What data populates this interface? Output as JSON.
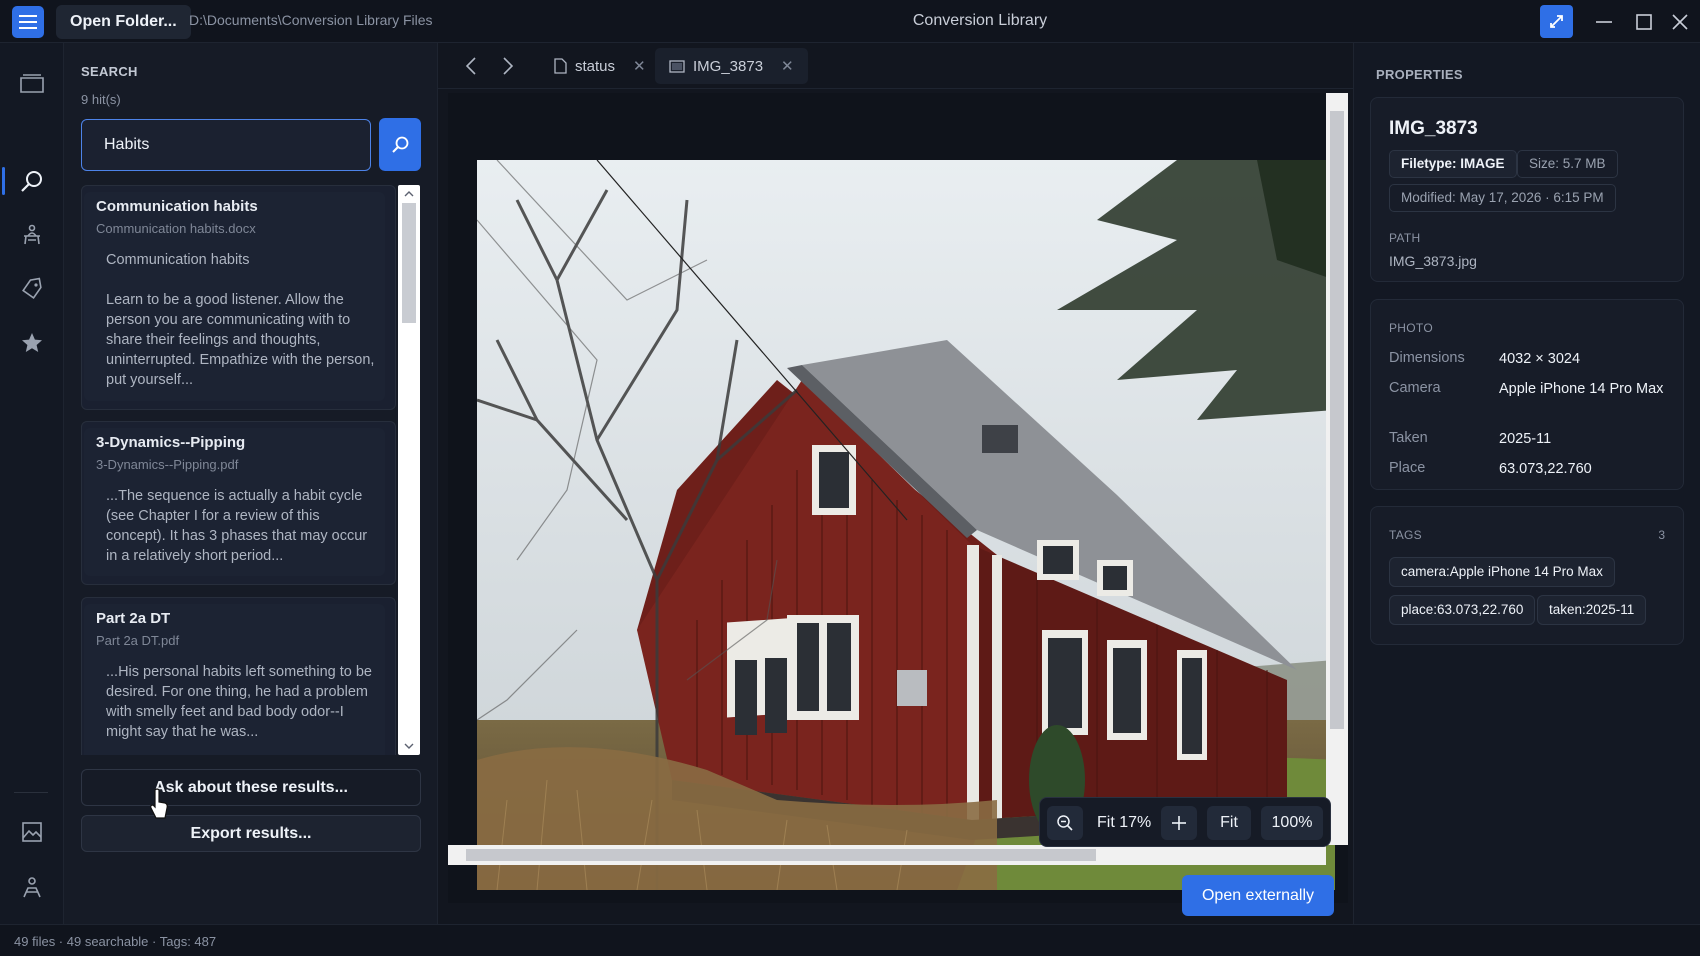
{
  "titlebar": {
    "open_folder_label": "Open Folder...",
    "path": "D:\\Documents\\Conversion Library Files",
    "app_title": "Conversion Library"
  },
  "search": {
    "heading": "SEARCH",
    "hits": "9 hit(s)",
    "query": "Habits",
    "results": [
      {
        "title": "Communication habits",
        "file": "Communication habits.docx",
        "snippet": "Communication  habits\n\nLearn to be a good listener.  Allow the person you are communicating with to share their feelings and thoughts, uninterrupted.  Empathize with the person, put yourself..."
      },
      {
        "title": "3-Dynamics--Pipping",
        "file": "3-Dynamics--Pipping.pdf",
        "snippet": "...The sequence is actually a habit cycle (see Chapter I for a review of this concept).  It has 3 phases that may occur in a relatively short period..."
      },
      {
        "title": "Part 2a DT",
        "file": "Part 2a DT.pdf",
        "snippet": "...His personal habits left something to be desired.  For one thing, he had a problem with smelly feet and bad body odor--I might say that he was..."
      }
    ],
    "ask_label": "Ask about these results...",
    "export_label": "Export results..."
  },
  "viewer": {
    "tabs": [
      {
        "label": "status",
        "icon": "file-icon"
      },
      {
        "label": "IMG_3873",
        "icon": "image-icon"
      }
    ],
    "zoom": {
      "fit_label": "Fit 17%",
      "fit_button": "Fit",
      "hundred_button": "100%"
    },
    "open_externally_label": "Open externally"
  },
  "properties": {
    "heading": "PROPERTIES",
    "title": "IMG_3873",
    "filetype": "Filetype: IMAGE",
    "size": "Size: 5.7 MB",
    "modified": "Modified: May 17, 2026 · 6:15 PM",
    "path_label": "PATH",
    "path_value": "IMG_3873.jpg",
    "photo_label": "PHOTO",
    "photo": [
      {
        "key": "Dimensions",
        "value": "4032 × 3024"
      },
      {
        "key": "Camera",
        "value": "Apple iPhone 14 Pro Max"
      },
      {
        "key": "Taken",
        "value": "2025-11"
      },
      {
        "key": "Place",
        "value": "63.073,22.760"
      }
    ],
    "tags_label": "TAGS",
    "tags_count": "3",
    "tags": [
      "camera:Apple iPhone 14 Pro Max",
      "place:63.073,22.760",
      "taken:2025-11"
    ]
  },
  "statusbar": {
    "text": "49 files · 49 searchable · Tags: 487"
  },
  "colors": {
    "accent": "#2f6fe6",
    "background": "#10141d",
    "panel": "#161b26",
    "house_red": "#6e1f1a"
  }
}
